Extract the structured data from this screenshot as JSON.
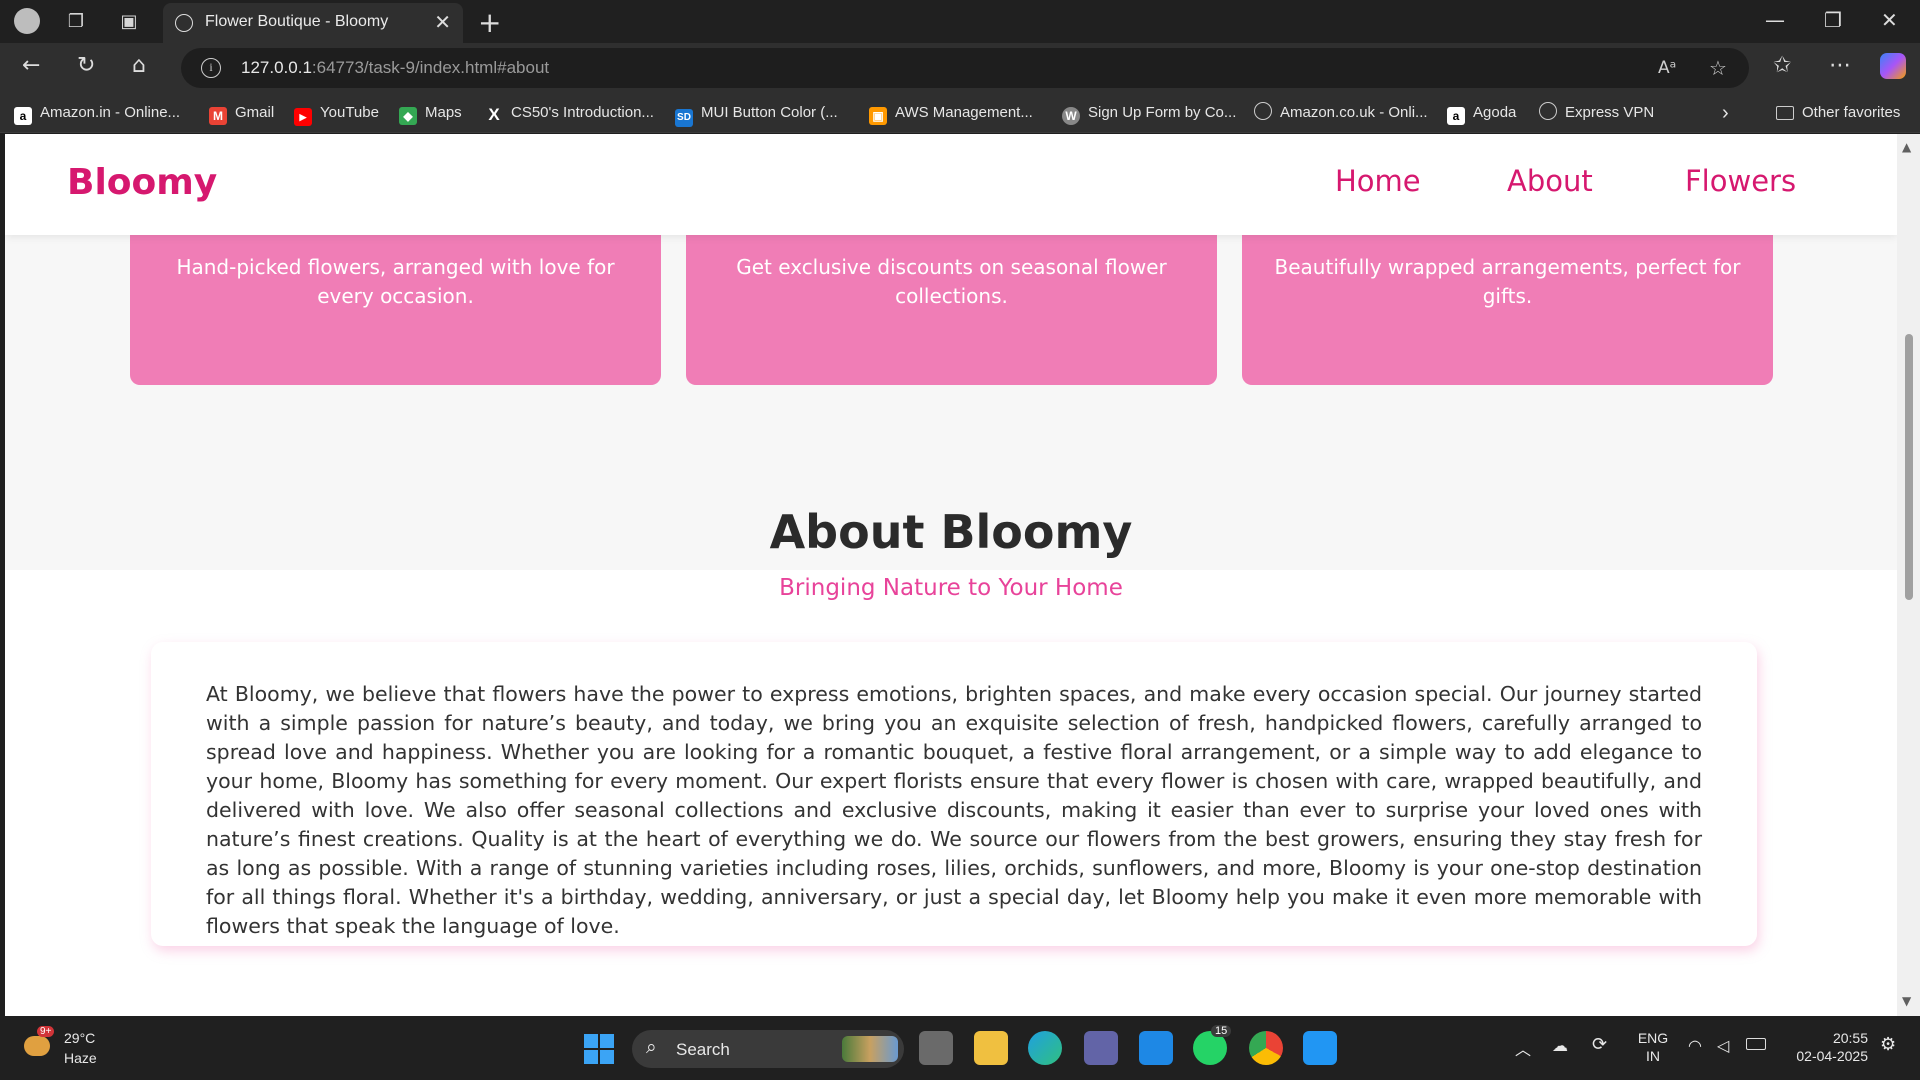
{
  "browser": {
    "tab_title": "Flower Boutique - Bloomy",
    "url_host": "127.0.0.1",
    "url_rest": ":64773/task-9/index.html#about",
    "bookmarks": [
      {
        "label": "Amazon.in - Online...",
        "icon": "amazon-icon",
        "color": "#ffffff"
      },
      {
        "label": "Gmail",
        "icon": "gmail-icon",
        "color": "#ea4335"
      },
      {
        "label": "YouTube",
        "icon": "youtube-icon",
        "color": "#ff0000"
      },
      {
        "label": "Maps",
        "icon": "maps-icon",
        "color": "#34a853"
      },
      {
        "label": "CS50's Introduction...",
        "icon": "x-icon",
        "color": "#000000"
      },
      {
        "label": "MUI Button Color (...",
        "icon": "sd-icon",
        "color": "#1976d2"
      },
      {
        "label": "AWS Management...",
        "icon": "aws-icon",
        "color": "#ff9900"
      },
      {
        "label": "Sign Up Form by Co...",
        "icon": "wordpress-icon",
        "color": "#888888"
      },
      {
        "label": "Amazon.co.uk - Onli...",
        "icon": "globe-icon",
        "color": "#888888"
      },
      {
        "label": "Agoda",
        "icon": "agoda-icon",
        "color": "#ffffff"
      },
      {
        "label": "Express VPN",
        "icon": "globe-icon",
        "color": "#888888"
      }
    ],
    "other_favorites": "Other favorites"
  },
  "site": {
    "logo": "Bloomy",
    "nav": [
      "Home",
      "About",
      "Flowers"
    ],
    "features": [
      "Hand-picked flowers, arranged with love for every occasion.",
      "Get exclusive discounts on seasonal flower collections.",
      "Beautifully wrapped arrangements, perfect for gifts."
    ],
    "about_title": "About Bloomy",
    "about_subtitle": "Bringing Nature to Your Home",
    "about_text": "At Bloomy, we believe that flowers have the power to express emotions, brighten spaces, and make every occasion special. Our journey started with a simple passion for nature’s beauty, and today, we bring you an exquisite selection of fresh, handpicked flowers, carefully arranged to spread love and happiness. Whether you are looking for a romantic bouquet, a festive floral arrangement, or a simple way to add elegance to your home, Bloomy has something for every moment. Our expert florists ensure that every flower is chosen with care, wrapped beautifully, and delivered with love. We also offer seasonal collections and exclusive discounts, making it easier than ever to surprise your loved ones with nature’s finest creations. Quality is at the heart of everything we do. We source our flowers from the best growers, ensuring they stay fresh for as long as possible. With a range of stunning varieties including roses, lilies, orchids, sunflowers, and more, Bloomy is your one-stop destination for all things floral. Whether it's a birthday, wedding, anniversary, or just a special day, let Bloomy help you make it even more memorable with flowers that speak the language of love.",
    "colors": {
      "brand": "#d6186f",
      "card": "#f07db6",
      "subtitle": "#e8439a"
    }
  },
  "taskbar": {
    "weather_temp": "29°C",
    "weather_desc": "Haze",
    "weather_badge": "9+",
    "search_label": "Search",
    "whatsapp_badge": "15",
    "lang_1": "ENG",
    "lang_2": "IN",
    "time": "20:55",
    "date": "02-04-2025"
  }
}
